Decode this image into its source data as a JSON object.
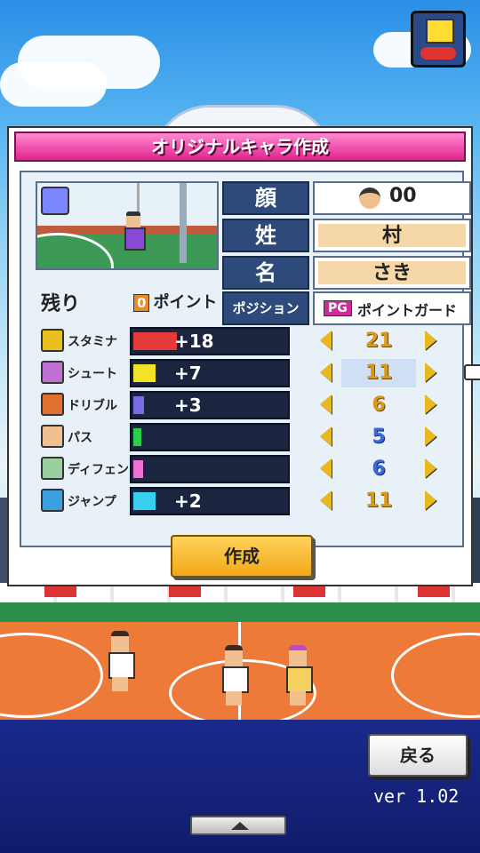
{
  "dialog": {
    "title": "オリジナルキャラ作成",
    "remaining_label": "残り",
    "points_value": "0",
    "points_label": "ポイント"
  },
  "profile": {
    "face_label": "顔",
    "face_value": "00",
    "surname_label": "姓",
    "surname_value": "村",
    "given_label": "名",
    "given_value": "さき",
    "position_label": "ポジション",
    "position_badge": "PG",
    "position_value": "ポイントガード"
  },
  "stats": [
    {
      "name": "スタミナ",
      "bonus": "+18",
      "value": "21",
      "bar_color": "#e53a3a",
      "icon_color": "#e8c020",
      "fill": 0.28
    },
    {
      "name": "シュート",
      "bonus": "+7",
      "value": "11",
      "bar_color": "#f2e228",
      "icon_color": "#c070d0",
      "fill": 0.14
    },
    {
      "name": "ドリブル",
      "bonus": "+3",
      "value": "6",
      "bar_color": "#7a6ae8",
      "icon_color": "#e07030",
      "fill": 0.07
    },
    {
      "name": "パス",
      "bonus": "",
      "value": "5",
      "bar_color": "#2ad04a",
      "icon_color": "#f0c090",
      "fill": 0.05
    },
    {
      "name": "ディフェンス",
      "bonus": "",
      "value": "6",
      "bar_color": "#ee70d0",
      "icon_color": "#9ad0a0",
      "fill": 0.06
    },
    {
      "name": "ジャンプ",
      "bonus": "+2",
      "value": "11",
      "bar_color": "#38d0f0",
      "icon_color": "#3aa0e0",
      "fill": 0.14
    }
  ],
  "create_button": "作成",
  "back_button": "戻る",
  "version": "ver 1.02"
}
